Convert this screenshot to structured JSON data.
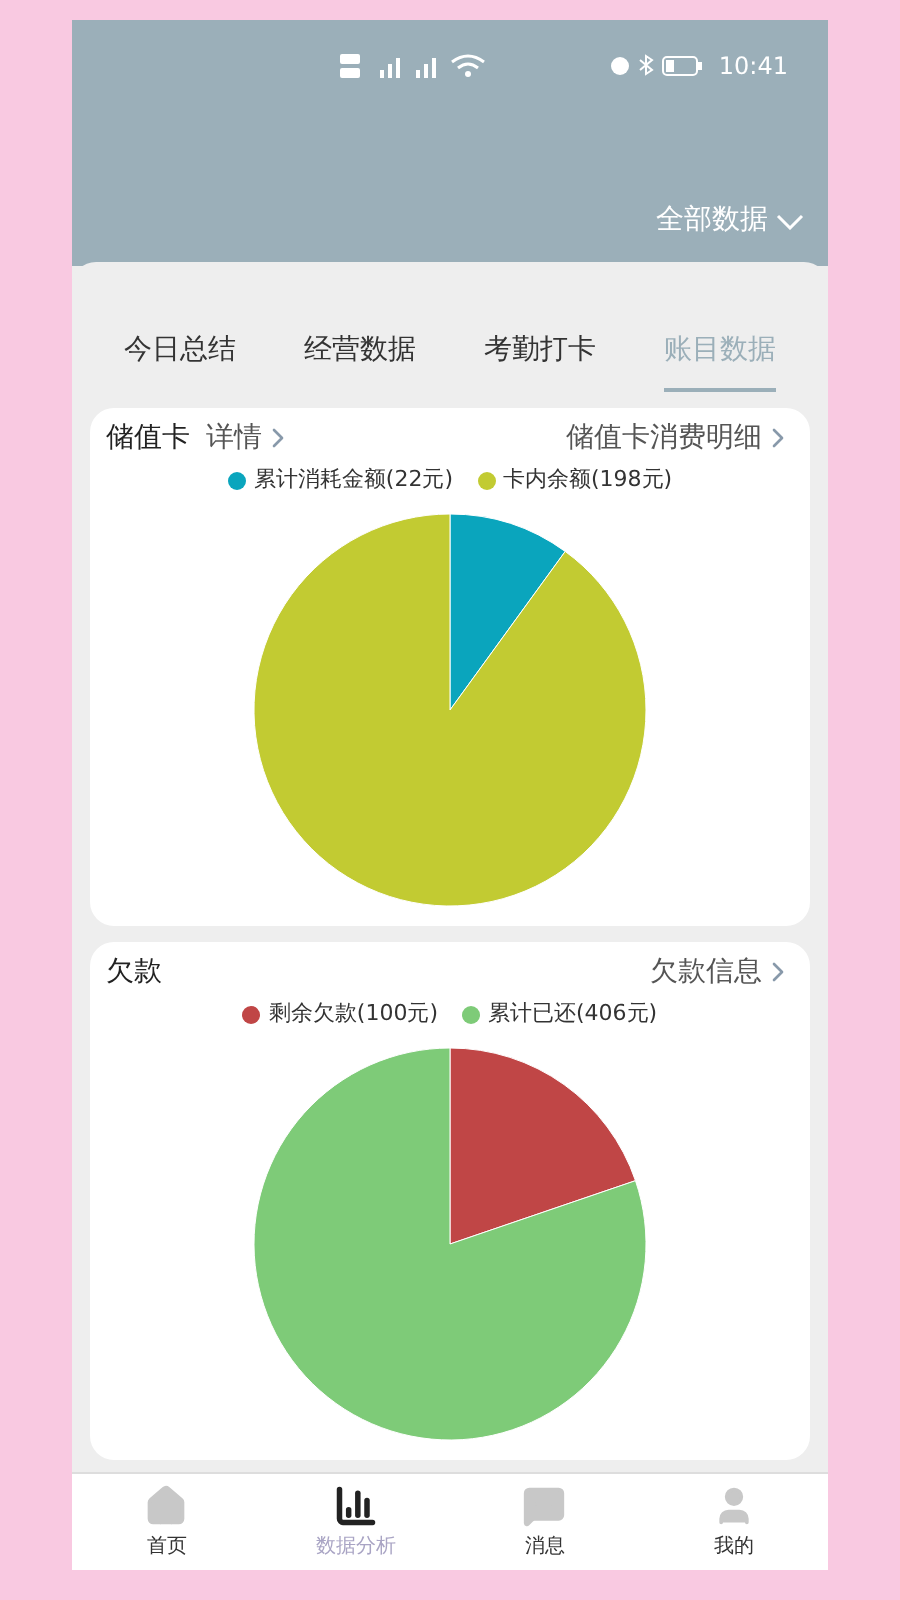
{
  "status_bar": {
    "time": "10:41"
  },
  "header": {
    "filter": "全部数据"
  },
  "tabs": [
    {
      "label": "今日总结",
      "selected": false
    },
    {
      "label": "经营数据",
      "selected": false
    },
    {
      "label": "考勤打卡",
      "selected": false
    },
    {
      "label": "账目数据",
      "selected": true
    }
  ],
  "cards": [
    {
      "title": "储值卡",
      "detail_link": "详情",
      "right_link": "储值卡消费明细",
      "chart_data": {
        "type": "pie",
        "categories": [
          "累计消耗金额(22元)",
          "卡内余额(198元)"
        ],
        "values": [
          22,
          198
        ],
        "colors": [
          "#0aa5bd",
          "#c2cb32"
        ]
      }
    },
    {
      "title": "欠款",
      "right_link": "欠款信息",
      "chart_data": {
        "type": "pie",
        "categories": [
          "剩余欠款(100元)",
          "累计已还(406元)"
        ],
        "values": [
          100,
          406
        ],
        "colors": [
          "#c04646",
          "#7ecb78"
        ]
      }
    }
  ],
  "bottom_nav": [
    {
      "label": "首页",
      "selected": false
    },
    {
      "label": "数据分析",
      "selected": true
    },
    {
      "label": "消息",
      "selected": false
    },
    {
      "label": "我的",
      "selected": false
    }
  ]
}
